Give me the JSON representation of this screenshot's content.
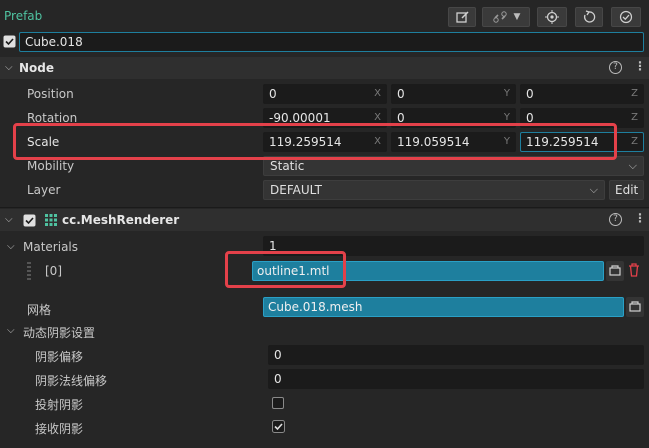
{
  "title": "Prefab",
  "node_name": "Cube.018",
  "node_section": {
    "title": "Node",
    "position": {
      "label": "Position",
      "x": "0",
      "y": "0",
      "z": "0"
    },
    "rotation": {
      "label": "Rotation",
      "x": "-90.00001",
      "y": "0",
      "z": "0"
    },
    "scale": {
      "label": "Scale",
      "x": "119.259514",
      "y": "119.059514",
      "z": "119.259514"
    },
    "axis": {
      "x": "X",
      "y": "Y",
      "z": "Z"
    },
    "mobility": {
      "label": "Mobility",
      "value": "Static"
    },
    "layer": {
      "label": "Layer",
      "value": "DEFAULT",
      "edit": "Edit"
    }
  },
  "mesh_renderer": {
    "title": "cc.MeshRenderer",
    "materials": {
      "label": "Materials",
      "count": "1",
      "index": "[0]",
      "value": "outline1.mtl"
    },
    "mesh": {
      "label": "网格",
      "value": "Cube.018.mesh"
    },
    "shadow_group": {
      "label": "动态阴影设置",
      "bias": {
        "label": "阴影偏移",
        "value": "0"
      },
      "normal_bias": {
        "label": "阴影法线偏移",
        "value": "0"
      },
      "cast": {
        "label": "投射阴影",
        "checked": false
      },
      "receive": {
        "label": "接收阴影",
        "checked": true
      }
    }
  },
  "colors": {
    "accent": "#1e7f9e",
    "highlight": "#e4414a",
    "title": "#4fc3a1"
  }
}
